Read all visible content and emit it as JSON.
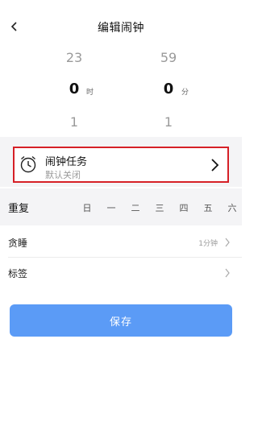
{
  "header": {
    "title": "编辑闹钟",
    "back_icon": "chevron-left-icon"
  },
  "picker": {
    "hours": {
      "above": "23",
      "selected": "0",
      "below": "1",
      "unit": "时"
    },
    "minutes": {
      "above": "59",
      "selected": "0",
      "below": "1",
      "unit": "分"
    }
  },
  "task": {
    "title": "闹钟任务",
    "subtitle": "默认关闭",
    "icon": "alarm-clock-icon"
  },
  "repeat": {
    "label": "重复",
    "days": [
      "日",
      "一",
      "二",
      "三",
      "四",
      "五",
      "六"
    ]
  },
  "snooze": {
    "label": "贪睡",
    "value": "1分钟"
  },
  "tag": {
    "label": "标签"
  },
  "save": {
    "label": "保存"
  },
  "colors": {
    "accent": "#5b9bf6",
    "highlight_border": "#d62027",
    "band_bg": "#f4f4f6"
  }
}
